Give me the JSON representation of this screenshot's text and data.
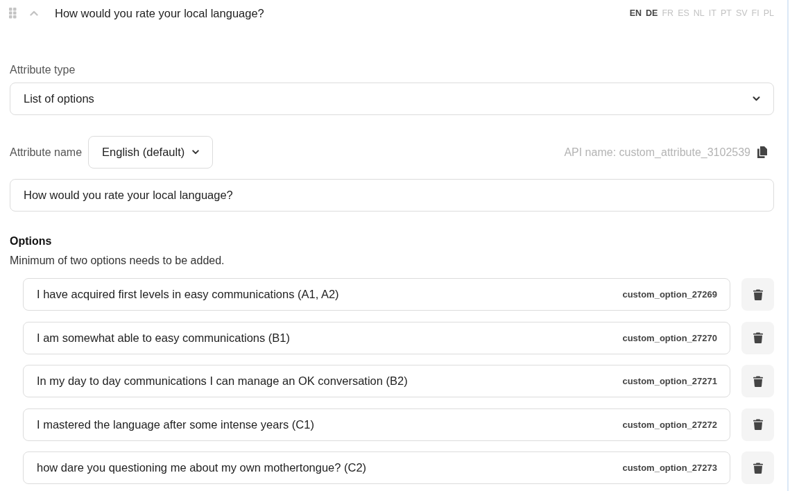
{
  "header": {
    "title": "How would you rate your local language?",
    "languages": [
      {
        "code": "EN",
        "translated": true
      },
      {
        "code": "DE",
        "translated": true
      },
      {
        "code": "FR",
        "translated": false
      },
      {
        "code": "ES",
        "translated": false
      },
      {
        "code": "NL",
        "translated": false
      },
      {
        "code": "IT",
        "translated": false
      },
      {
        "code": "PT",
        "translated": false
      },
      {
        "code": "SV",
        "translated": false
      },
      {
        "code": "FI",
        "translated": false
      },
      {
        "code": "PL",
        "translated": false
      }
    ]
  },
  "attribute_type": {
    "label": "Attribute type",
    "value": "List of options"
  },
  "attribute_name": {
    "label": "Attribute name",
    "language": "English (default)",
    "api_name": "API name: custom_attribute_3102539",
    "value": "How would you rate your local language?"
  },
  "options": {
    "title": "Options",
    "hint": "Minimum of two options needs to be added.",
    "items": [
      {
        "label": "I have acquired first levels in easy communications (A1, A2)",
        "api_name": "custom_option_27269"
      },
      {
        "label": "I am somewhat able to easy communications (B1)",
        "api_name": "custom_option_27270"
      },
      {
        "label": "In my day to day communications I can manage an OK conversation (B2)",
        "api_name": "custom_option_27271"
      },
      {
        "label": "I mastered the language after some intense years (C1)",
        "api_name": "custom_option_27272"
      },
      {
        "label": "how dare you questioning me about my own mothertongue? (C2)",
        "api_name": "custom_option_27273"
      }
    ]
  }
}
